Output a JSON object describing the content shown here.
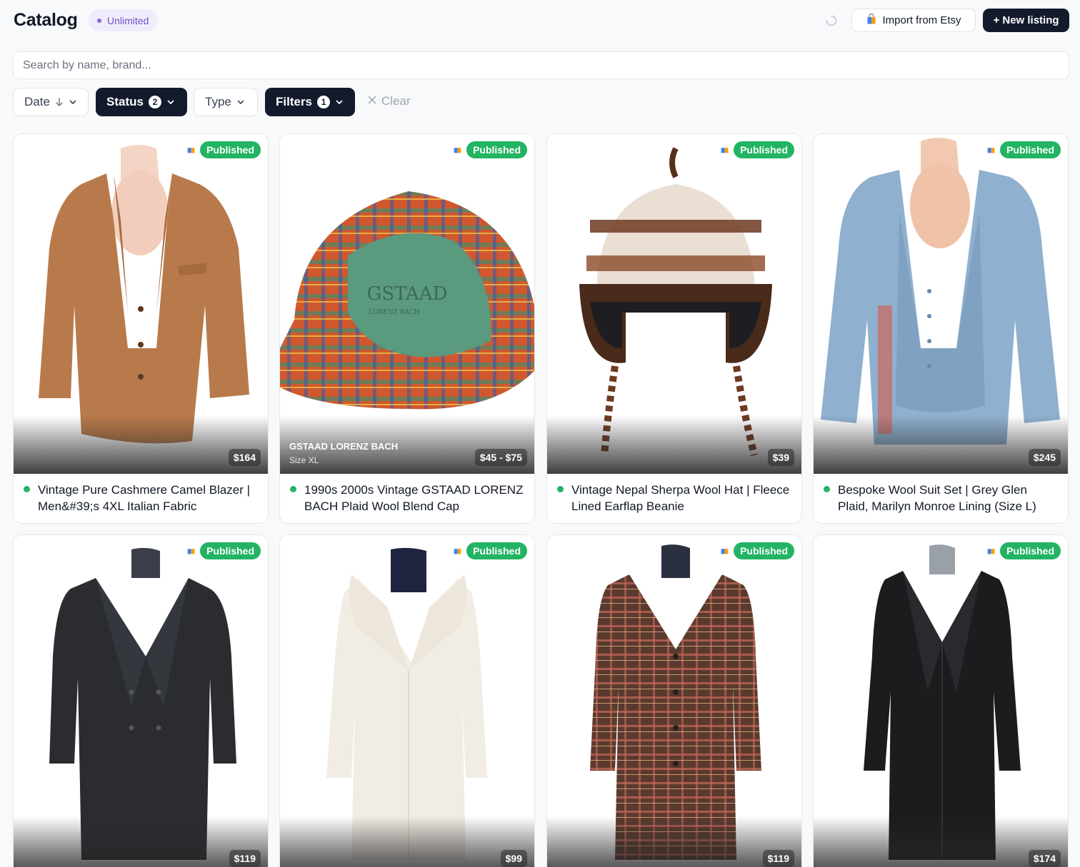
{
  "header": {
    "title": "Catalog",
    "plan_badge": "Unlimited",
    "import_label": "Import from Etsy",
    "new_listing_label": "+ New listing"
  },
  "search": {
    "placeholder": "Search by name, brand..."
  },
  "filters": {
    "date_label": "Date",
    "status_label": "Status",
    "status_count": "2",
    "type_label": "Type",
    "filters_label": "Filters",
    "filters_count": "1",
    "clear_label": "Clear"
  },
  "colors": {
    "accent_dark": "#121a2c",
    "published_green": "#22b463",
    "plan_purple": "#6d4fc9"
  },
  "listings": [
    {
      "status": "Published",
      "price": "$164",
      "title": "Vintage Pure Cashmere Camel Blazer | Men&#39;s 4XL Italian Fabric",
      "image": "camel-blazer"
    },
    {
      "status": "Published",
      "price": "$45 - $75",
      "brand": "GSTAAD LORENZ BACH",
      "size": "Size XL",
      "title": "1990s 2000s Vintage GSTAAD LORENZ BACH Plaid Wool Blend Cap",
      "image": "plaid-cap",
      "cap_text": "GSTAAD",
      "cap_subtext": "LORENZ BACH"
    },
    {
      "status": "Published",
      "price": "$39",
      "title": "Vintage Nepal Sherpa Wool Hat | Fleece Lined Earflap Beanie",
      "image": "sherpa-hat"
    },
    {
      "status": "Published",
      "price": "$245",
      "title": "Bespoke Wool Suit Set | Grey Glen Plaid, Marilyn Monroe Lining (Size L)",
      "image": "blue-suit"
    },
    {
      "status": "Published",
      "price": "$119",
      "title": "",
      "image": "black-coat"
    },
    {
      "status": "Published",
      "price": "$99",
      "title": "",
      "image": "cream-coat"
    },
    {
      "status": "Published",
      "price": "$119",
      "title": "",
      "image": "plaid-coat"
    },
    {
      "status": "Published",
      "price": "$174",
      "title": "",
      "image": "leather-coat"
    }
  ]
}
